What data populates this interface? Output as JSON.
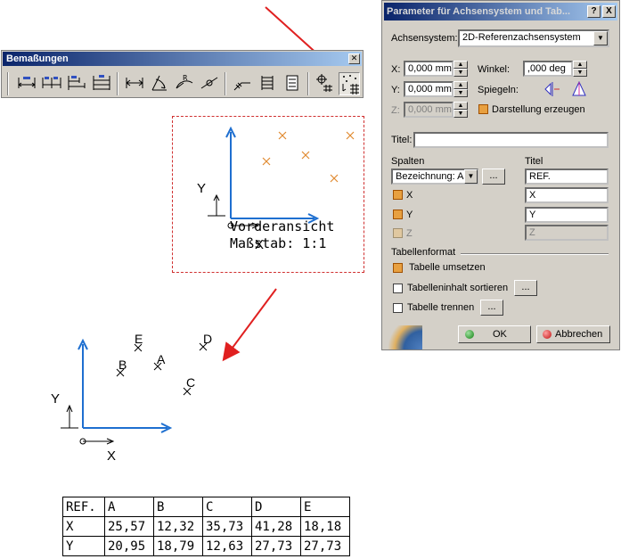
{
  "toolbar": {
    "title": "Bemaßungen",
    "close_glyph": "✕",
    "buttons": [
      "dimension-icon",
      "chained-dimension-icon",
      "cumulated-dimension-icon",
      "stacked-dimension-icon",
      "length-distance-icon",
      "angle-dimension-icon",
      "radius-dimension-icon",
      "diameter-dimension-icon",
      "chamfer-dimension-icon",
      "thread-dimension-icon",
      "coordinate-dimension-icon",
      "hole-dimension-table-icon",
      "point-coordinate-table-icon"
    ]
  },
  "view": {
    "name_line": "Vorderansicht",
    "scale_line": "Maßstab:  1:1",
    "axis_y": "Y",
    "axis_x": "X"
  },
  "result": {
    "axis_y": "Y",
    "axis_x": "X",
    "points": [
      "E",
      "B",
      "A",
      "D",
      "C"
    ]
  },
  "dialog": {
    "title": "Parameter für Achsensystem und Tab...",
    "help_glyph": "?",
    "close_glyph": "X",
    "axis_system_label": "Achsensystem:",
    "axis_system_value": "2D-Referenzachsensystem",
    "x_label": "X:",
    "x_value": "0,000 mm",
    "y_label": "Y:",
    "y_value": "0,000 mm",
    "z_label": "Z:",
    "z_value": "0,000 mm",
    "angle_label": "Winkel:",
    "angle_value": ",000 deg",
    "mirror_label": "Spiegeln:",
    "create_label": "Darstellung erzeugen",
    "title_label": "Titel:",
    "title_value": "",
    "columns_label": "Spalten",
    "titel_label": "Titel",
    "column_select": "Bezeichnung: A,",
    "column_title": "REF.",
    "x_check": "X",
    "x_title": "X",
    "y_check": "Y",
    "y_title": "Y",
    "z_check": "Z",
    "z_title": "Z",
    "table_format_label": "Tabellenformat",
    "transpose_label": "Tabelle umsetzen",
    "sort_label": "Tabelleninhalt sortieren",
    "split_label": "Tabelle trennen",
    "ellipsis": "...",
    "ok_label": "OK",
    "cancel_label": "Abbrechen"
  },
  "table": {
    "rows": [
      [
        "REF.",
        "A",
        "B",
        "C",
        "D",
        "E"
      ],
      [
        "X",
        "25,57",
        "12,32",
        "35,73",
        "41,28",
        "18,18"
      ],
      [
        "Y",
        "20,95",
        "18,79",
        "12,63",
        "27,73",
        "27,73"
      ]
    ]
  },
  "colors": {
    "arrow_red": "#e02020",
    "axis_blue": "#1e6fd0",
    "point_orange": "#e08a30",
    "frame_red": "#d03030"
  }
}
